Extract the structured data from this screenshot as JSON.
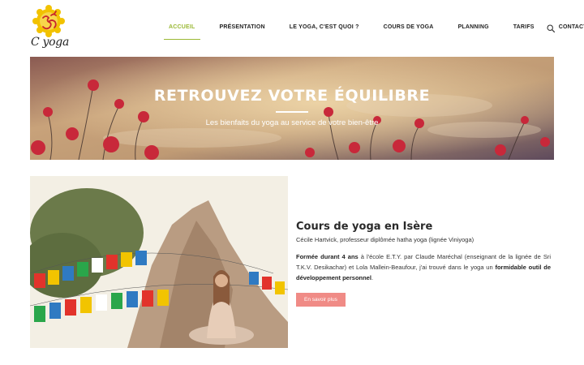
{
  "logo": {
    "text": "C yoga",
    "icon": "om-icon"
  },
  "nav": {
    "items": [
      {
        "label": "ACCUEIL",
        "active": true
      },
      {
        "label": "PRÉSENTATION",
        "active": false
      },
      {
        "label": "LE YOGA, C'EST QUOI ?",
        "active": false
      },
      {
        "label": "COURS DE YOGA",
        "active": false
      },
      {
        "label": "PLANNING",
        "active": false
      },
      {
        "label": "TARIFS",
        "active": false
      },
      {
        "label": "CONTACT",
        "active": false
      }
    ],
    "search_icon": "search-icon"
  },
  "hero": {
    "title": "RETROUVEZ VOTRE ÉQUILIBRE",
    "subtitle": "Les bienfaits du yoga au service de votre bien-être"
  },
  "content": {
    "title": "Cours de yoga en Isère",
    "subtitle": "Cécile Hartvick, professeur diplômée hatha yoga (lignée Viniyoga)",
    "body_bold1": "Formée durant 4 ans",
    "body_text1": " à l'école E.T.Y. par Claude Maréchal (enseignant de la lignée de Sri T.K.V. Desikachar) et Lola Mallein-Beaufour, j'ai trouvé dans le yoga un ",
    "body_bold2": "formidable outil de développement personnel",
    "body_text2": ".",
    "button_label": "En savoir plus"
  },
  "colors": {
    "accent_green": "#9ab834",
    "button_pink": "#f08b86",
    "logo_yellow": "#f2c200",
    "logo_red": "#c9252c"
  }
}
